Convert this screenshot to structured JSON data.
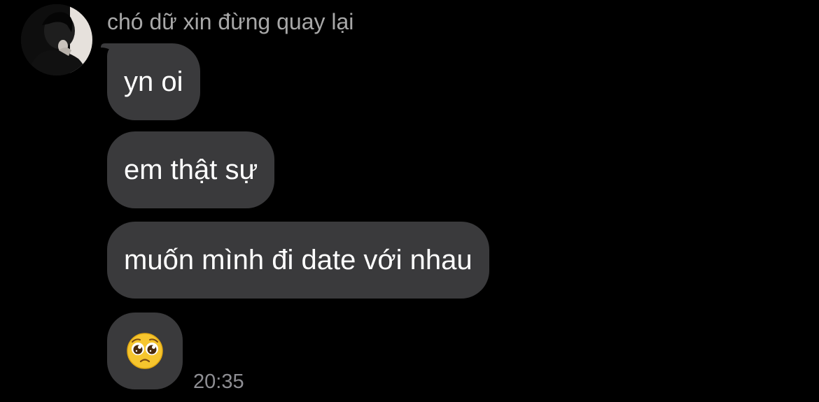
{
  "chat": {
    "sender_name": "chó dữ xin đừng quay lại",
    "messages": [
      {
        "text": "yn oi"
      },
      {
        "text": "em thật sự"
      },
      {
        "text": "muốn mình đi date với nhau"
      },
      {
        "emoji": "pleading-face-icon"
      }
    ],
    "timestamp": "20:35"
  },
  "colors": {
    "background": "#000000",
    "bubble": "#3a3a3c",
    "sender_name": "#a8a8a8",
    "timestamp": "#8e8e93"
  }
}
